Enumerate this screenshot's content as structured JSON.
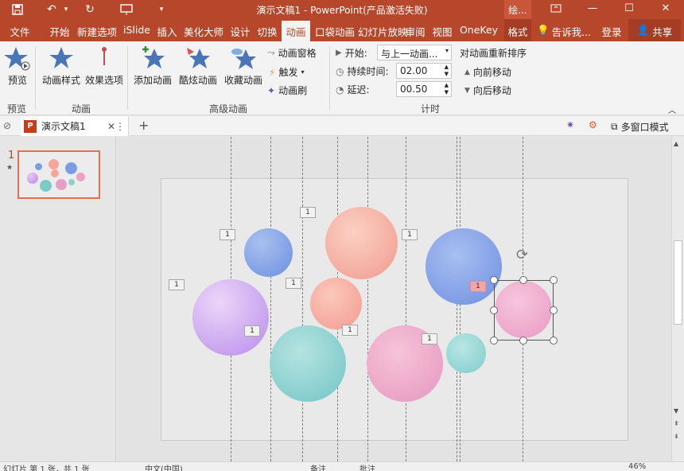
{
  "window": {
    "title": "演示文稿1 - PowerPoint(产品激活失败)",
    "context_tab": "绘...",
    "minimize": "—",
    "restore": "☐",
    "close": "✕"
  },
  "quick_access": {
    "save": "💾",
    "undo": "↶",
    "redo": "↻",
    "customize": "▾"
  },
  "tabs": [
    {
      "label": "文件"
    },
    {
      "label": "开始"
    },
    {
      "label": "新建选项"
    },
    {
      "label": "iSlide"
    },
    {
      "label": "插入"
    },
    {
      "label": "美化大师"
    },
    {
      "label": "设计"
    },
    {
      "label": "切换"
    },
    {
      "label": "动画"
    },
    {
      "label": "口袋动画"
    },
    {
      "label": "幻灯片放映"
    },
    {
      "label": "审阅"
    },
    {
      "label": "视图"
    },
    {
      "label": "OneKey"
    },
    {
      "label": "格式"
    }
  ],
  "tell_me": "告诉我...",
  "login": "登录",
  "share": "共享",
  "ribbon": {
    "preview": {
      "label": "预览",
      "group": "预览"
    },
    "animation_styles": "动画样式",
    "effect_options": "效果选项",
    "group_animation": "动画",
    "add_animation": "添加动画",
    "cool_animation": "酷炫动画",
    "collect_animation": "收藏动画",
    "animation_pane": "动画窗格",
    "trigger": "触发",
    "animation_painter": "动画刷",
    "group_advanced": "高级动画",
    "start_label": "开始:",
    "start_value": "与上一动画...",
    "duration_label": "持续时间:",
    "duration_value": "02.00",
    "delay_label": "延迟:",
    "delay_value": "00.50",
    "group_timing": "计时",
    "reorder_title": "对动画重新排序",
    "move_earlier": "向前移动",
    "move_later": "向后移动"
  },
  "doc_tab": {
    "name": "演示文稿1"
  },
  "multi_window": "多窗口模式",
  "thumbnail": {
    "number": "1",
    "star": "★"
  },
  "badges": [
    "1",
    "1",
    "1",
    "1",
    "1",
    "1",
    "1",
    "1",
    "1"
  ],
  "status": {
    "slide_info": "幻灯片 第 1 张，共 1 张",
    "language": "中文(中国)",
    "notes": "备注",
    "comments": "批注",
    "zoom": "46%"
  },
  "colors": {
    "accent": "#b7472a",
    "selected_badge": "#f4a6a0"
  }
}
